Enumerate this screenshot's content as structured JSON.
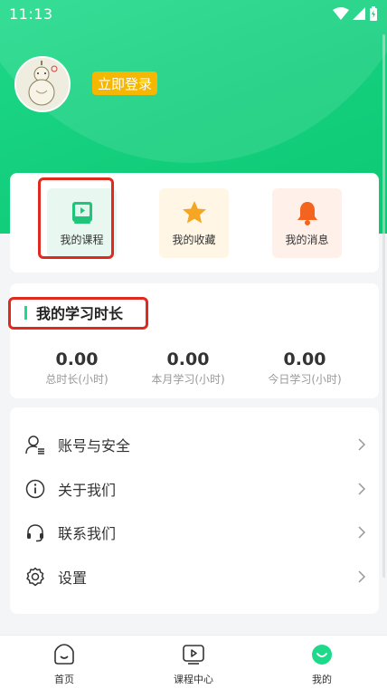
{
  "status_bar": {
    "time": "11:13"
  },
  "header": {
    "login_label": "立即登录"
  },
  "quick_actions": [
    {
      "label": "我的课程",
      "icon": "course-book-icon",
      "bg": "#e8f8f0"
    },
    {
      "label": "我的收藏",
      "icon": "star-icon",
      "bg": "#fff6e6"
    },
    {
      "label": "我的消息",
      "icon": "bell-icon",
      "bg": "#fff1ea"
    }
  ],
  "study": {
    "title": "我的学习时长",
    "stats": [
      {
        "value": "0.00",
        "label": "总时长(小时)"
      },
      {
        "value": "0.00",
        "label": "本月学习(小时)"
      },
      {
        "value": "0.00",
        "label": "今日学习(小时)"
      }
    ]
  },
  "menu": [
    {
      "label": "账号与安全",
      "icon": "user-account-icon"
    },
    {
      "label": "关于我们",
      "icon": "info-icon"
    },
    {
      "label": "联系我们",
      "icon": "headset-icon"
    },
    {
      "label": "设置",
      "icon": "gear-icon"
    }
  ],
  "tabbar": [
    {
      "label": "首页",
      "icon": "home-icon",
      "active": false
    },
    {
      "label": "课程中心",
      "icon": "play-icon",
      "active": false
    },
    {
      "label": "我的",
      "icon": "smile-icon",
      "active": true
    }
  ],
  "colors": {
    "brand_green": "#1fd98a",
    "login_yellow": "#f5b700",
    "highlight_red": "#e02a20"
  }
}
